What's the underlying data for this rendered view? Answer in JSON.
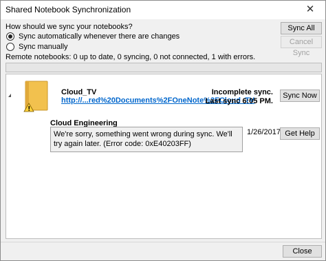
{
  "window": {
    "title": "Shared Notebook Synchronization",
    "close_glyph": "✕"
  },
  "sync": {
    "question": "How should we sync your notebooks?",
    "options": [
      {
        "label": "Sync automatically whenever there are changes",
        "selected": true
      },
      {
        "label": "Sync manually",
        "selected": false
      }
    ],
    "sync_all_label": "Sync All",
    "cancel_sync_label": "Cancel Sync",
    "status_text": "Remote notebooks: 0 up to date, 0 syncing, 0 not connected, 1 with errors.",
    "progress": 0
  },
  "notebook": {
    "name": "Cloud_TV",
    "link": "http://...red%20Documents%2FOneNote%2FCloud_TV",
    "status": "Incomplete sync.",
    "last_sync": "Last sync 6:05 PM.",
    "sync_now_label": "Sync Now",
    "icon": "notebook-warning-icon",
    "icon_color": "#f2c14e"
  },
  "section": {
    "name": "Cloud Engineering",
    "error_message": "We're sorry, something went wrong during sync. We'll try again later. (Error code: 0xE40203FF)",
    "date": "1/26/2017",
    "get_help_label": "Get Help"
  },
  "footer": {
    "close_label": "Close"
  }
}
